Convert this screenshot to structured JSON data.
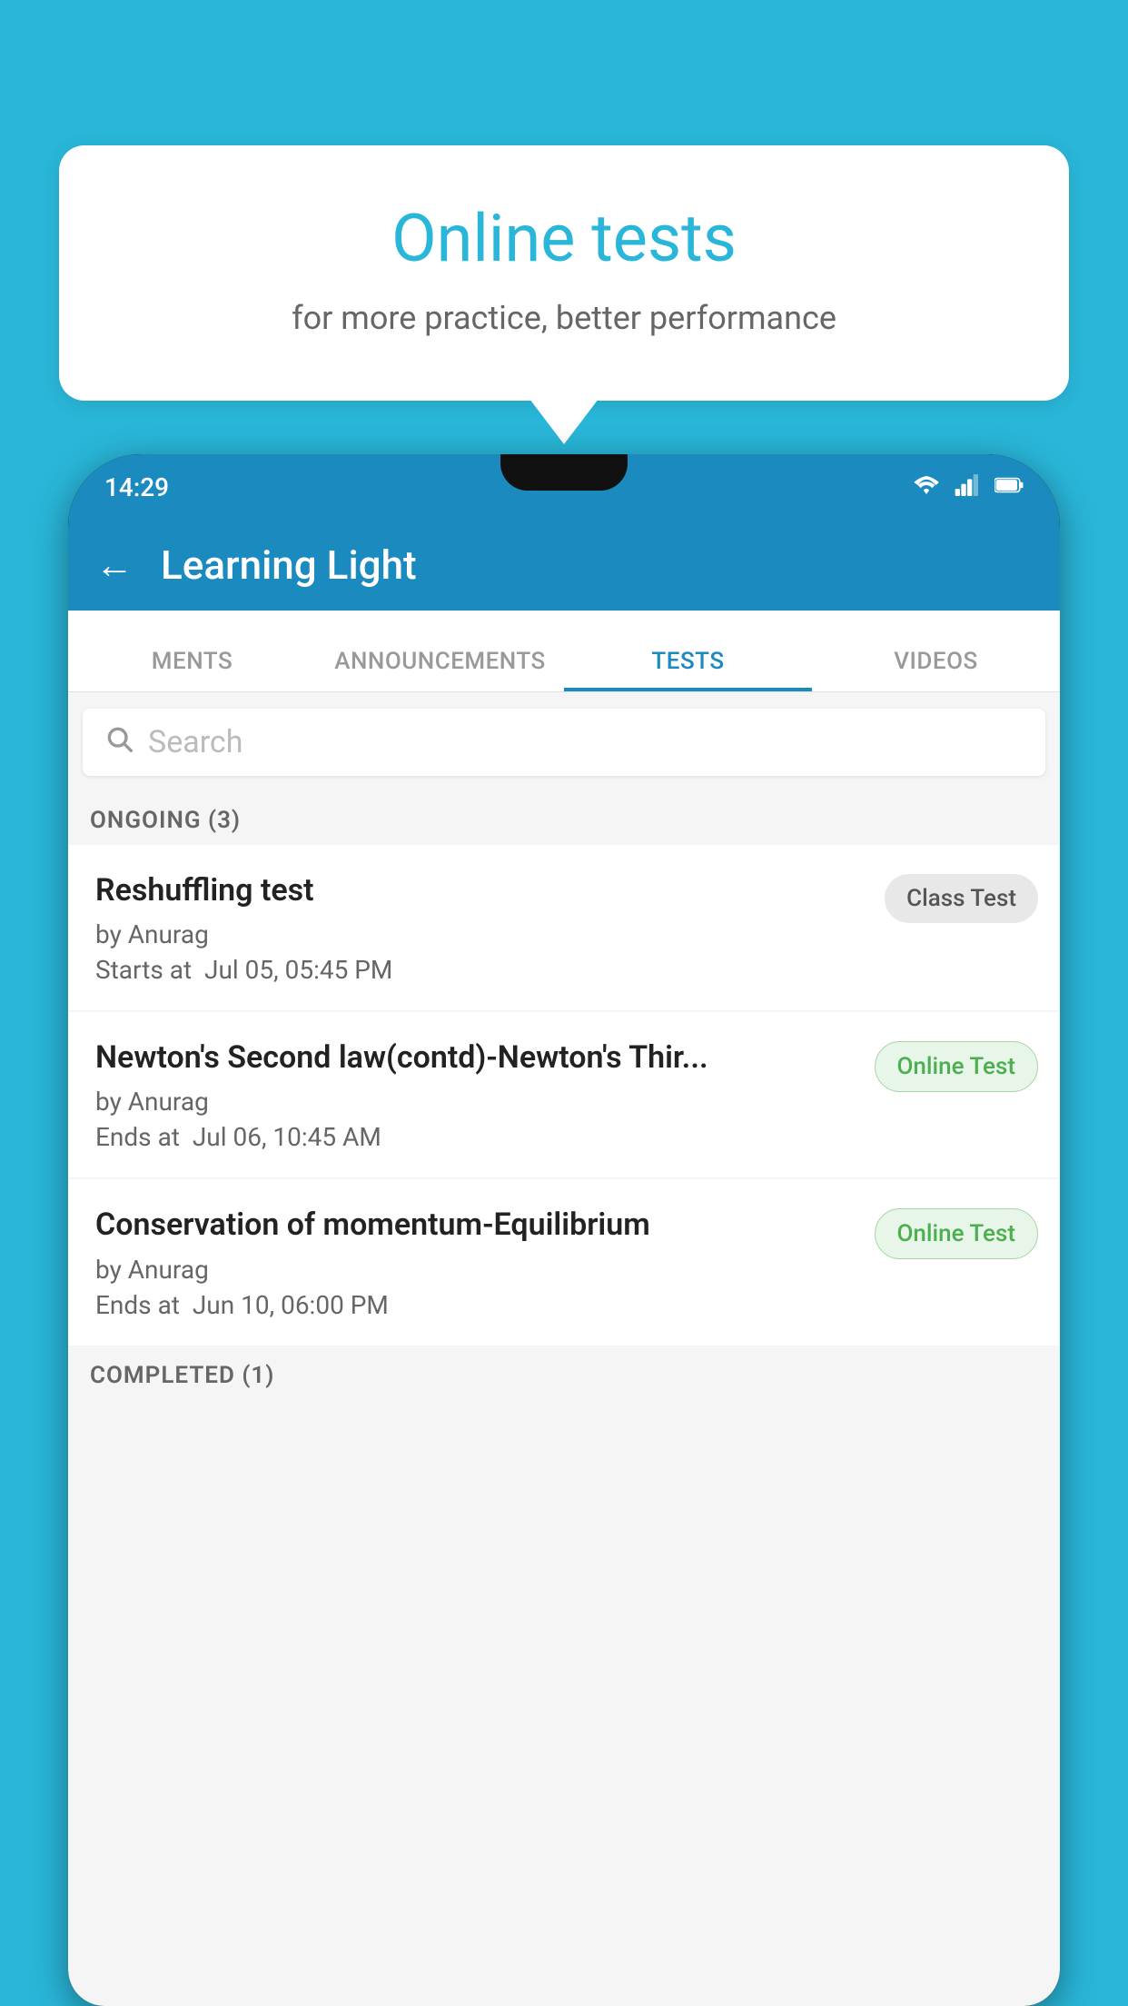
{
  "background_color": "#29b6d8",
  "bubble": {
    "title": "Online tests",
    "subtitle": "for more practice, better performance"
  },
  "status_bar": {
    "time": "14:29",
    "icons": [
      "wifi",
      "signal",
      "battery"
    ]
  },
  "app_bar": {
    "title": "Learning Light",
    "back_label": "←"
  },
  "tabs": [
    {
      "label": "MENTS",
      "active": false
    },
    {
      "label": "ANNOUNCEMENTS",
      "active": false
    },
    {
      "label": "TESTS",
      "active": true
    },
    {
      "label": "VIDEOS",
      "active": false
    }
  ],
  "search": {
    "placeholder": "Search"
  },
  "ongoing_section": {
    "header": "ONGOING (3)",
    "tests": [
      {
        "name": "Reshuffling test",
        "author": "by Anurag",
        "date_label": "Starts at",
        "date": "Jul 05, 05:45 PM",
        "badge": "Class Test",
        "badge_type": "class"
      },
      {
        "name": "Newton's Second law(contd)-Newton's Thir...",
        "author": "by Anurag",
        "date_label": "Ends at",
        "date": "Jul 06, 10:45 AM",
        "badge": "Online Test",
        "badge_type": "online"
      },
      {
        "name": "Conservation of momentum-Equilibrium",
        "author": "by Anurag",
        "date_label": "Ends at",
        "date": "Jun 10, 06:00 PM",
        "badge": "Online Test",
        "badge_type": "online"
      }
    ]
  },
  "completed_section": {
    "header": "COMPLETED (1)"
  }
}
